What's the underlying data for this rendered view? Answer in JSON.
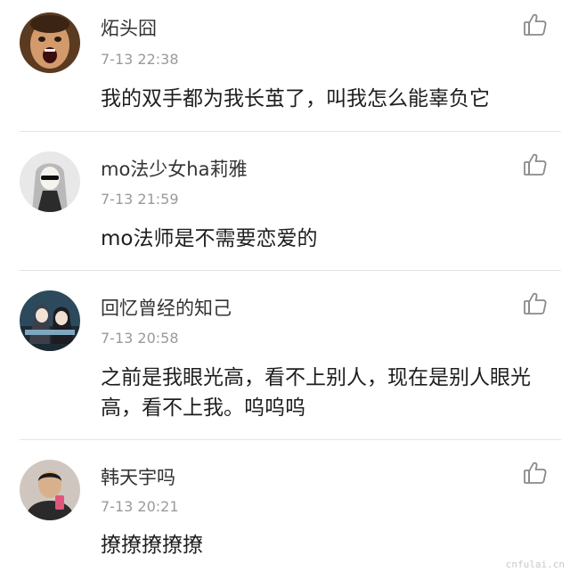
{
  "comments": [
    {
      "username": "炻头囧",
      "time": "7-13 22:38",
      "text": "我的双手都为我长茧了，叫我怎么能辜负它",
      "avatar": "angry-man-avatar"
    },
    {
      "username": "mo法少女ha莉雅",
      "time": "7-13 21:59",
      "text": "mo法师是不需要恋爱的",
      "avatar": "anime-girl-avatar"
    },
    {
      "username": "回忆曾经的知己",
      "time": "7-13 20:58",
      "text": "之前是我眼光高，看不上别人，现在是别人眼光高，看不上我。呜呜呜",
      "avatar": "anime-pair-avatar"
    },
    {
      "username": "韩天宇吗",
      "time": "7-13 20:21",
      "text": "撩撩撩撩撩",
      "avatar": "selfie-boy-avatar"
    }
  ],
  "watermark": "cnfulai.cn",
  "colors": {
    "time": "#9a9a9a",
    "divider": "#e4e4e4",
    "like_icon": "#8a8a8a"
  }
}
